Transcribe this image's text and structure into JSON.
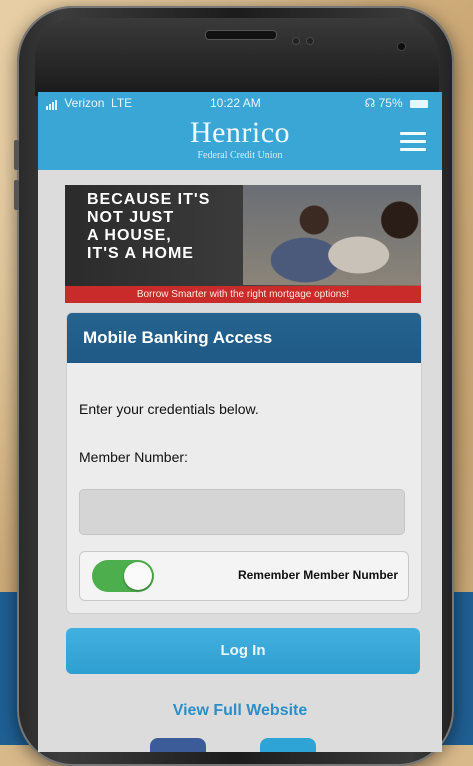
{
  "status_bar": {
    "carrier": "Verizon",
    "network": "LTE",
    "time": "10:22 AM",
    "battery": "75%"
  },
  "header": {
    "brand": "Henrico",
    "brand_sub": "Federal Credit Union",
    "menu_icon": "hamburger-menu-icon"
  },
  "banner": {
    "headline": "BECAUSE IT'S\nNOT JUST\nA HOUSE,\nIT'S A HOME",
    "strip": "Borrow Smarter with the right mortgage options!"
  },
  "login_card": {
    "title": "Mobile Banking Access",
    "instructions": "Enter your credentials below.",
    "member_label": "Member Number:",
    "member_value": "",
    "remember_label": "Remember Member Number",
    "remember_on": true
  },
  "actions": {
    "login": "Log In",
    "full_site": "View Full Website"
  },
  "colors": {
    "header_blue": "#3aa6d6",
    "card_title_blue": "#1f5985",
    "toggle_green": "#4cae4c",
    "banner_red": "#c92a2a"
  }
}
